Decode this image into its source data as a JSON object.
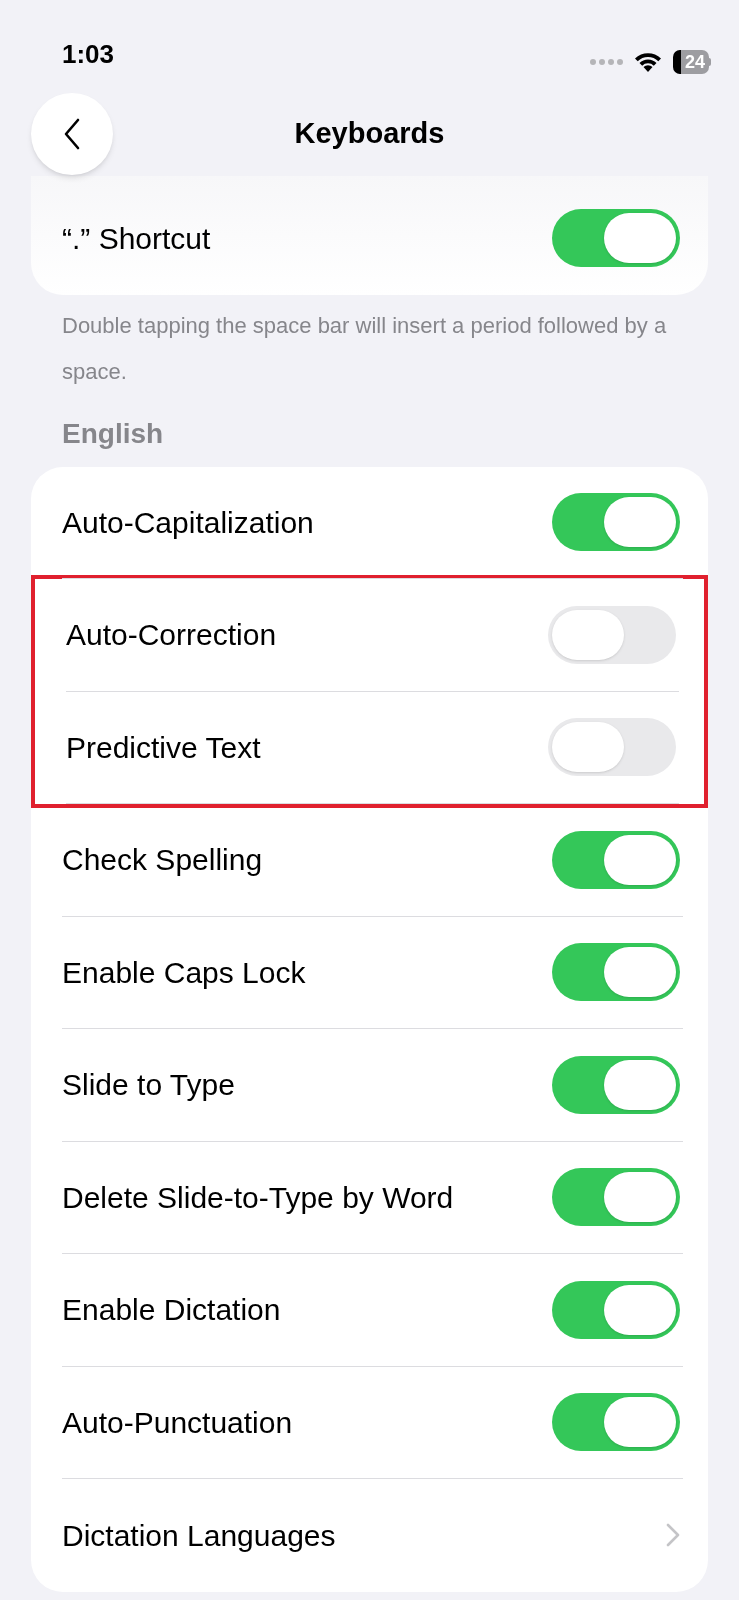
{
  "status_bar": {
    "time": "1:03",
    "battery": "24"
  },
  "nav": {
    "title": "Keyboards"
  },
  "top_group": {
    "rows": [
      {
        "kind": "toggle",
        "label": "“.” Shortcut",
        "on": true,
        "highlighted": false
      }
    ],
    "footer": "Double tapping the space bar will insert a period followed by a space."
  },
  "english": {
    "header": "English",
    "rows": [
      {
        "kind": "toggle",
        "label": "Auto-Capitalization",
        "on": true,
        "highlighted": false
      },
      {
        "kind": "toggle",
        "label": "Auto-Correction",
        "on": false,
        "highlighted": true
      },
      {
        "kind": "toggle",
        "label": "Predictive Text",
        "on": false,
        "highlighted": true
      },
      {
        "kind": "toggle",
        "label": "Check Spelling",
        "on": true,
        "highlighted": false
      },
      {
        "kind": "toggle",
        "label": "Enable Caps Lock",
        "on": true,
        "highlighted": false
      },
      {
        "kind": "toggle",
        "label": "Slide to Type",
        "on": true,
        "highlighted": false
      },
      {
        "kind": "toggle",
        "label": "Delete Slide-to-Type by Word",
        "on": true,
        "highlighted": false
      },
      {
        "kind": "toggle",
        "label": "Enable Dictation",
        "on": true,
        "highlighted": false
      },
      {
        "kind": "toggle",
        "label": "Auto-Punctuation",
        "on": true,
        "highlighted": false
      },
      {
        "kind": "link",
        "label": "Dictation Languages",
        "highlighted": false
      }
    ]
  }
}
